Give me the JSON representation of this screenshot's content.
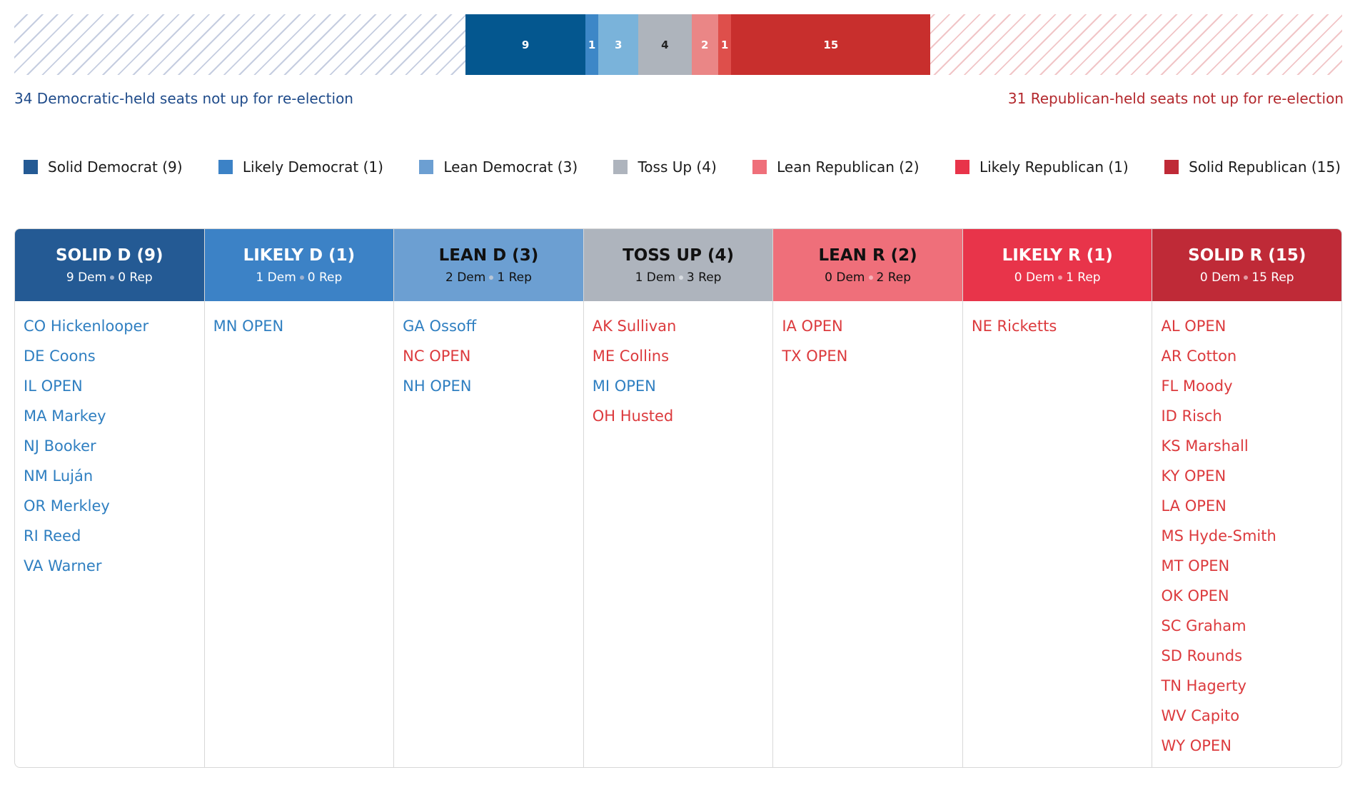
{
  "colors": {
    "solid_d": "#245a94",
    "likely_d": "#3c82c6",
    "lean_d": "#6c9fd2",
    "tossup": "#aeb4bd",
    "lean_r": "#ef6f7a",
    "likely_r": "#e8344a",
    "solid_r": "#bf2a37",
    "bar_solid_d": "#04578f",
    "bar_likely_d": "#3d87c7",
    "bar_lean_d": "#7ab3da",
    "bar_tossup": "#aeb4bc",
    "bar_lean_r": "#ea8686",
    "bar_likely_r": "#de4f4b",
    "bar_solid_r": "#c82f2d",
    "dem_text": "#2f7fc1",
    "rep_text": "#dc3a3d"
  },
  "chart_data": {
    "type": "bar",
    "orientation": "horizontal-stacked",
    "categories": [
      "Solid Democrat",
      "Likely Democrat",
      "Lean Democrat",
      "Toss Up",
      "Lean Republican",
      "Likely Republican",
      "Solid Republican"
    ],
    "values": [
      9,
      1,
      3,
      4,
      2,
      1,
      15
    ],
    "not_up_dem": 34,
    "not_up_rep": 31
  },
  "notup": {
    "dem_text": "34 Democratic-held seats not up for re-election",
    "rep_text": "31 Republican-held seats not up for re-election"
  },
  "legend": [
    {
      "label": "Solid Democrat (9)",
      "color": "#245a94"
    },
    {
      "label": "Likely Democrat (1)",
      "color": "#3c82c6"
    },
    {
      "label": "Lean Democrat (3)",
      "color": "#6c9fd2"
    },
    {
      "label": "Toss Up (4)",
      "color": "#aeb4bd"
    },
    {
      "label": "Lean Republican (2)",
      "color": "#ef6f7a"
    },
    {
      "label": "Likely Republican (1)",
      "color": "#e8344a"
    },
    {
      "label": "Solid Republican (15)",
      "color": "#bf2a37"
    }
  ],
  "columns": [
    {
      "title": "SOLID D (9)",
      "dem": "9 Dem",
      "rep": "0 Rep",
      "races": [
        {
          "name": "CO Hickenlooper",
          "party": "dem"
        },
        {
          "name": "DE Coons",
          "party": "dem"
        },
        {
          "name": "IL OPEN",
          "party": "dem"
        },
        {
          "name": "MA Markey",
          "party": "dem"
        },
        {
          "name": "NJ Booker",
          "party": "dem"
        },
        {
          "name": "NM Luján",
          "party": "dem"
        },
        {
          "name": "OR Merkley",
          "party": "dem"
        },
        {
          "name": "RI Reed",
          "party": "dem"
        },
        {
          "name": "VA Warner",
          "party": "dem"
        }
      ]
    },
    {
      "title": "LIKELY D (1)",
      "dem": "1 Dem",
      "rep": "0 Rep",
      "races": [
        {
          "name": "MN OPEN",
          "party": "dem"
        }
      ]
    },
    {
      "title": "LEAN D (3)",
      "dem": "2 Dem",
      "rep": "1 Rep",
      "races": [
        {
          "name": "GA Ossoff",
          "party": "dem"
        },
        {
          "name": "NC OPEN",
          "party": "rep"
        },
        {
          "name": "NH OPEN",
          "party": "dem"
        }
      ]
    },
    {
      "title": "TOSS UP (4)",
      "dem": "1 Dem",
      "rep": "3 Rep",
      "races": [
        {
          "name": "AK Sullivan",
          "party": "rep"
        },
        {
          "name": "ME Collins",
          "party": "rep"
        },
        {
          "name": "MI OPEN",
          "party": "dem"
        },
        {
          "name": "OH Husted",
          "party": "rep"
        }
      ]
    },
    {
      "title": "LEAN R (2)",
      "dem": "0 Dem",
      "rep": "2 Rep",
      "races": [
        {
          "name": "IA OPEN",
          "party": "rep"
        },
        {
          "name": "TX OPEN",
          "party": "rep"
        }
      ]
    },
    {
      "title": "LIKELY R (1)",
      "dem": "0 Dem",
      "rep": "1 Rep",
      "races": [
        {
          "name": "NE Ricketts",
          "party": "rep"
        }
      ]
    },
    {
      "title": "SOLID R (15)",
      "dem": "0 Dem",
      "rep": "15 Rep",
      "races": [
        {
          "name": "AL OPEN",
          "party": "rep"
        },
        {
          "name": "AR Cotton",
          "party": "rep"
        },
        {
          "name": "FL Moody",
          "party": "rep"
        },
        {
          "name": "ID Risch",
          "party": "rep"
        },
        {
          "name": "KS Marshall",
          "party": "rep"
        },
        {
          "name": "KY OPEN",
          "party": "rep"
        },
        {
          "name": "LA OPEN",
          "party": "rep"
        },
        {
          "name": "MS Hyde-Smith",
          "party": "rep"
        },
        {
          "name": "MT OPEN",
          "party": "rep"
        },
        {
          "name": "OK OPEN",
          "party": "rep"
        },
        {
          "name": "SC Graham",
          "party": "rep"
        },
        {
          "name": "SD Rounds",
          "party": "rep"
        },
        {
          "name": "TN Hagerty",
          "party": "rep"
        },
        {
          "name": "WV Capito",
          "party": "rep"
        },
        {
          "name": "WY OPEN",
          "party": "rep"
        }
      ]
    }
  ]
}
